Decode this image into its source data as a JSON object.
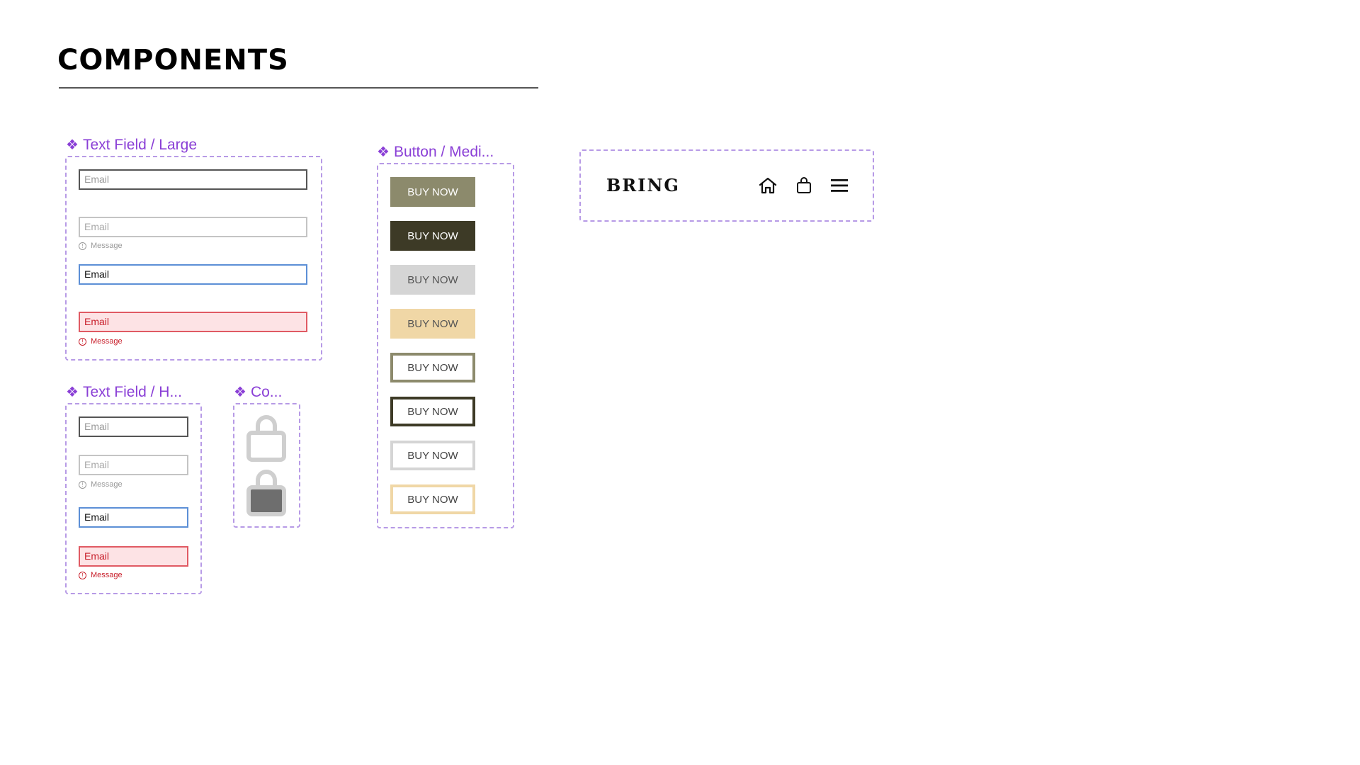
{
  "page": {
    "title": "COMPONENTS"
  },
  "text_field_large": {
    "label": "Text Field / Large",
    "fields": [
      {
        "state": "default",
        "value": "Email"
      },
      {
        "state": "disabled",
        "value": "Email",
        "helper": "Message"
      },
      {
        "state": "focused",
        "value": "Email"
      },
      {
        "state": "error",
        "value": "Email",
        "helper": "Message"
      }
    ]
  },
  "text_field_half": {
    "label": "Text Field / H...",
    "fields": [
      {
        "state": "default",
        "value": "Email"
      },
      {
        "state": "disabled",
        "value": "Email",
        "helper": "Message"
      },
      {
        "state": "focused",
        "value": "Email"
      },
      {
        "state": "error",
        "value": "Email",
        "helper": "Message"
      }
    ]
  },
  "cart_component": {
    "label": "Co...",
    "icons": [
      "bag-outline-icon",
      "bag-filled-icon"
    ]
  },
  "button_medium": {
    "label": "Button / Medi...",
    "buttons": [
      {
        "label": "BUY NOW",
        "variant": "filled",
        "color": "#8c8a6c"
      },
      {
        "label": "BUY NOW",
        "variant": "filled",
        "color": "#3d3a26"
      },
      {
        "label": "BUY NOW",
        "variant": "filled",
        "color": "#d5d5d5"
      },
      {
        "label": "BUY NOW",
        "variant": "filled",
        "color": "#f0d7a6"
      },
      {
        "label": "BUY NOW",
        "variant": "outline",
        "color": "#8c8a6c"
      },
      {
        "label": "BUY NOW",
        "variant": "outline",
        "color": "#3d3a26"
      },
      {
        "label": "BUY NOW",
        "variant": "outline",
        "color": "#d5d5d5"
      },
      {
        "label": "BUY NOW",
        "variant": "outline",
        "color": "#f0d7a6"
      }
    ]
  },
  "navbar": {
    "brand": "BRING",
    "icons": [
      "home-icon",
      "shopping-bag-icon",
      "hamburger-menu-icon"
    ]
  },
  "colors": {
    "component_label": "#8a3fd6",
    "frame_border": "#b79ae6",
    "error": "#c81e2a",
    "focus": "#5c8fd6"
  }
}
